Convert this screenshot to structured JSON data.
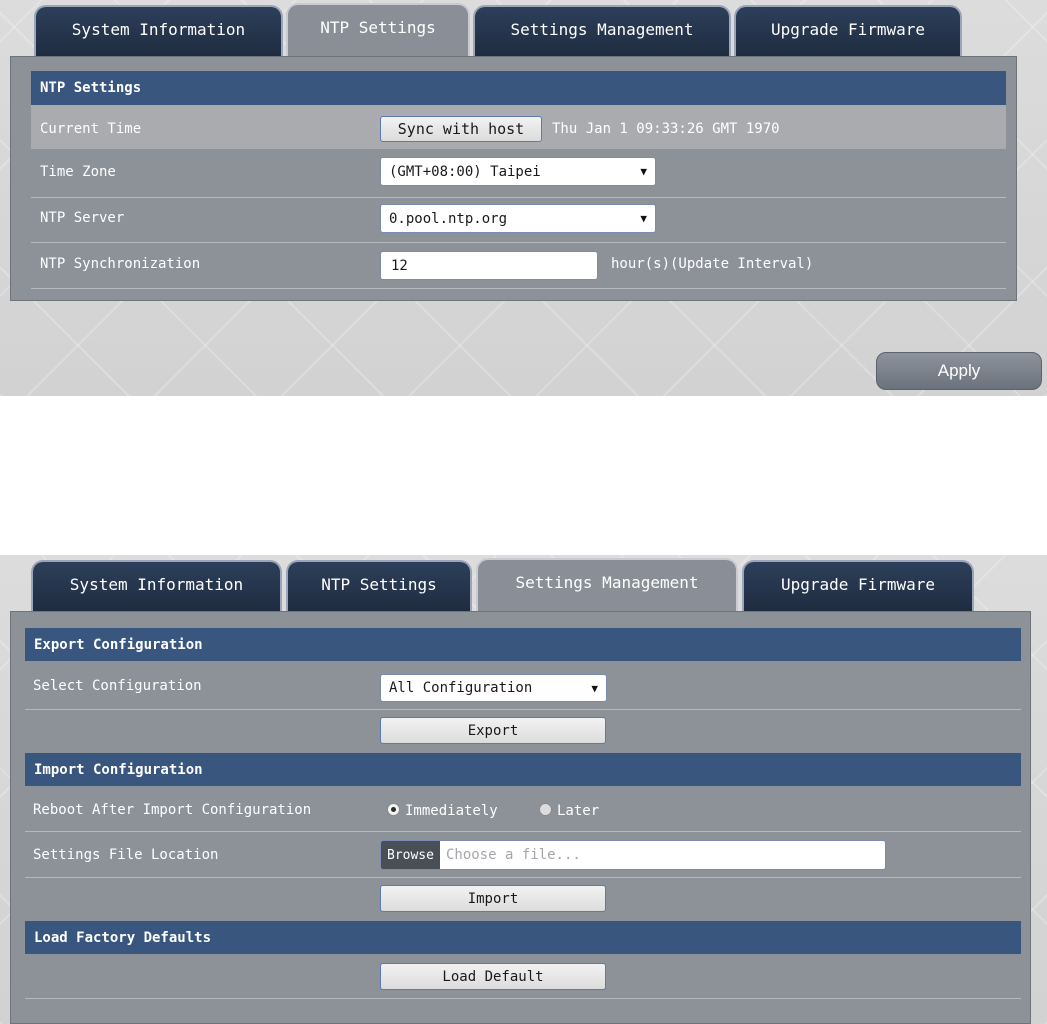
{
  "ntp_panel": {
    "tabs": [
      {
        "label": "System Information"
      },
      {
        "label": "NTP Settings"
      },
      {
        "label": "Settings Management"
      },
      {
        "label": "Upgrade Firmware"
      }
    ],
    "active_tab": "NTP Settings",
    "section_title": "NTP Settings",
    "current_time": {
      "label": "Current Time",
      "button": "Sync with host",
      "value": "Thu Jan 1 09:33:26 GMT 1970"
    },
    "time_zone": {
      "label": "Time Zone",
      "selected": "(GMT+08:00) Taipei"
    },
    "ntp_server": {
      "label": "NTP Server",
      "selected": "0.pool.ntp.org"
    },
    "ntp_sync": {
      "label": "NTP Synchronization",
      "value": "12",
      "unit": "hour(s)(Update Interval)"
    },
    "apply_label": "Apply"
  },
  "settings_panel": {
    "tabs": [
      {
        "label": "System Information"
      },
      {
        "label": "NTP Settings"
      },
      {
        "label": "Settings Management"
      },
      {
        "label": "Upgrade Firmware"
      }
    ],
    "active_tab": "Settings Management",
    "export": {
      "title": "Export Configuration",
      "select_label": "Select Configuration",
      "selected": "All Configuration",
      "button": "Export"
    },
    "import": {
      "title": "Import Configuration",
      "reboot_label": "Reboot After Import Configuration",
      "option_immediately": "Immediately",
      "option_later": "Later",
      "selected_option": "Immediately",
      "file_label": "Settings File Location",
      "browse_button": "Browse",
      "file_placeholder": "Choose a file...",
      "button": "Import"
    },
    "factory": {
      "title": "Load Factory Defaults",
      "button": "Load Default"
    }
  },
  "colors": {
    "section_header": "#39567f",
    "content_bg": "#8d9198",
    "tab_bg": "#1f2c40",
    "button_border": "#5a7bb5"
  },
  "icons": {
    "dropdown": "caret-down-icon",
    "radio": "radio-button-icon"
  }
}
